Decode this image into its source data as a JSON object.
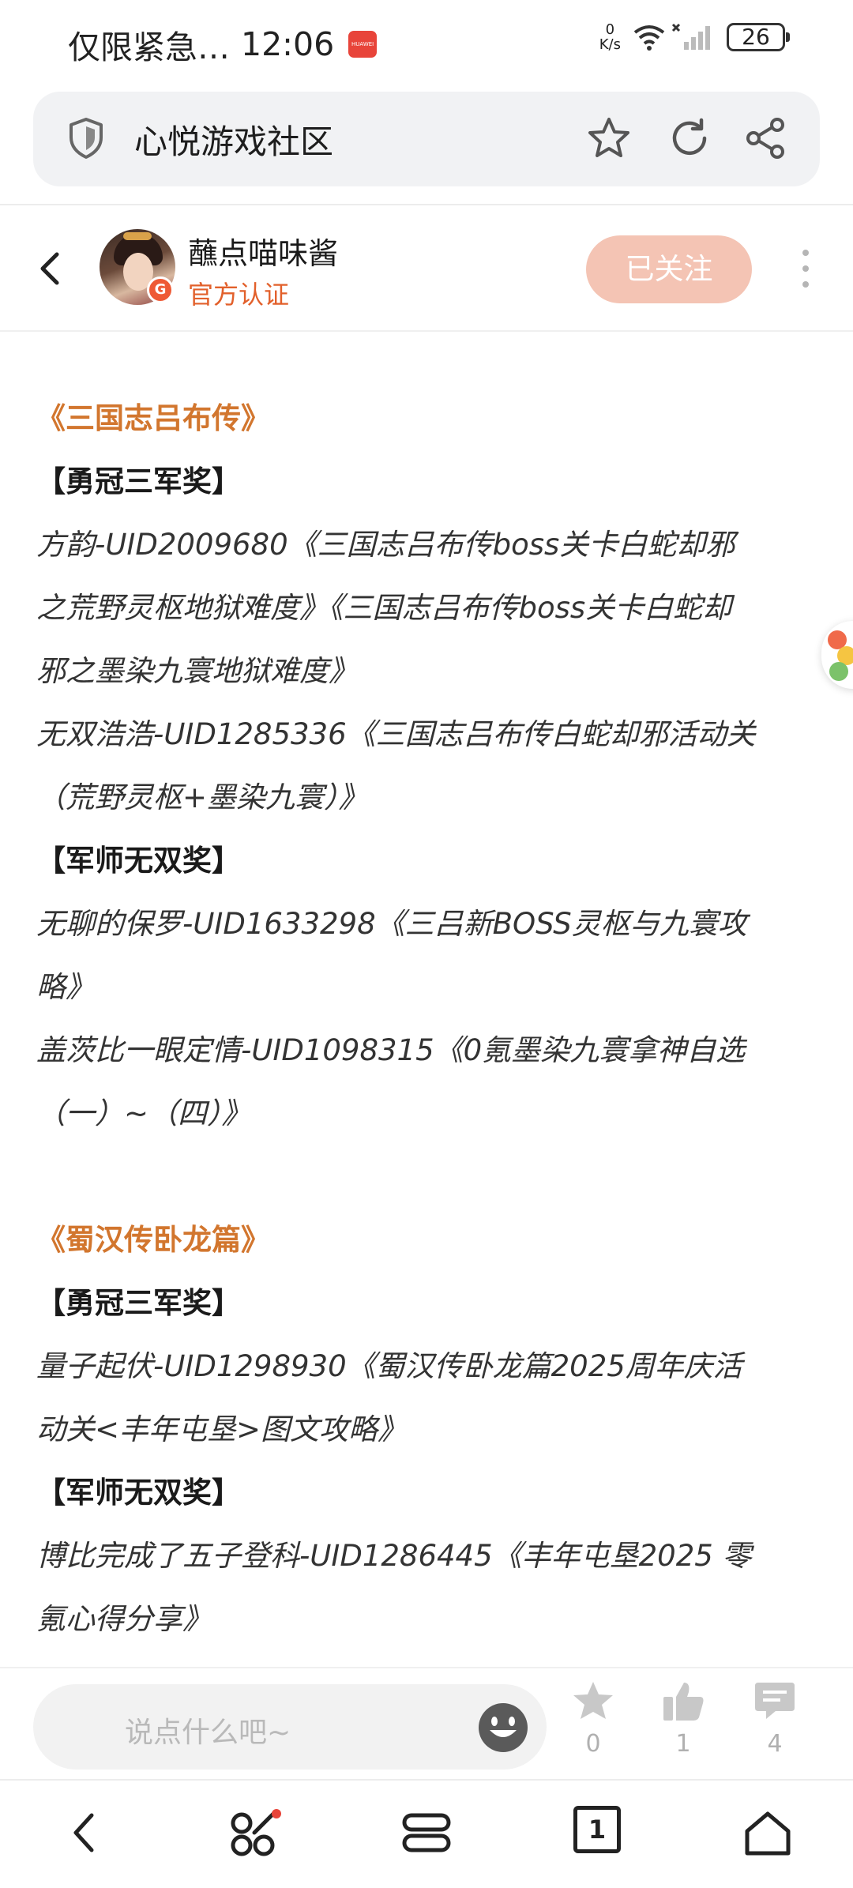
{
  "status_bar": {
    "notification_text": "仅限紧急…",
    "time": "12:06",
    "huawei_label": "HUAWEI",
    "net_speed_value": "0",
    "net_speed_unit": "K/s",
    "battery": "26"
  },
  "browser": {
    "site_title": "心悦游戏社区"
  },
  "post_header": {
    "author_name": "蘸点喵味酱",
    "author_tag": "官方认证",
    "badge_glyph": "G",
    "follow_label": "已关注"
  },
  "article": {
    "sections": [
      {
        "title": "《三国志吕布传》",
        "awards": [
          {
            "title": "【勇冠三军奖】",
            "entries": [
              [
                "方韵-UID2009680《三国志吕布传boss关卡白蛇却邪",
                "之荒野灵枢地狱难度》《三国志吕布传boss关卡白蛇却",
                "邪之墨染九寰地狱难度》"
              ],
              [
                "无双浩浩-UID1285336《三国志吕布传白蛇却邪活动关",
                "（荒野灵枢+墨染九寰）》"
              ]
            ]
          },
          {
            "title": "【军师无双奖】",
            "entries": [
              [
                "无聊的保罗-UID1633298《三吕新BOSS灵枢与九寰攻",
                "略》"
              ],
              [
                "盖茨比一眼定情-UID1098315《0氪墨染九寰拿神自选",
                "（一）~（四）》"
              ]
            ]
          }
        ]
      },
      {
        "title": "《蜀汉传卧龙篇》",
        "awards": [
          {
            "title": "【勇冠三军奖】",
            "entries": [
              [
                "量子起伏-UID1298930《蜀汉传卧龙篇2025周年庆活",
                "动关<丰年屯垦>图文攻略》"
              ]
            ]
          },
          {
            "title": "【军师无双奖】",
            "entries": [
              [
                "博比完成了五子登科-UID1286445《丰年屯垦2025 零",
                "氪心得分享》"
              ]
            ]
          }
        ]
      }
    ]
  },
  "comment_bar": {
    "placeholder": "说点什么吧~",
    "favorites_count": "0",
    "likes_count": "1",
    "comments_count": "4"
  },
  "nav": {
    "tabs_count": "1"
  },
  "colors": {
    "accent_orange": "#d2762e",
    "follow_button_bg": "#f4c4b4",
    "tag_red": "#e2602b"
  }
}
